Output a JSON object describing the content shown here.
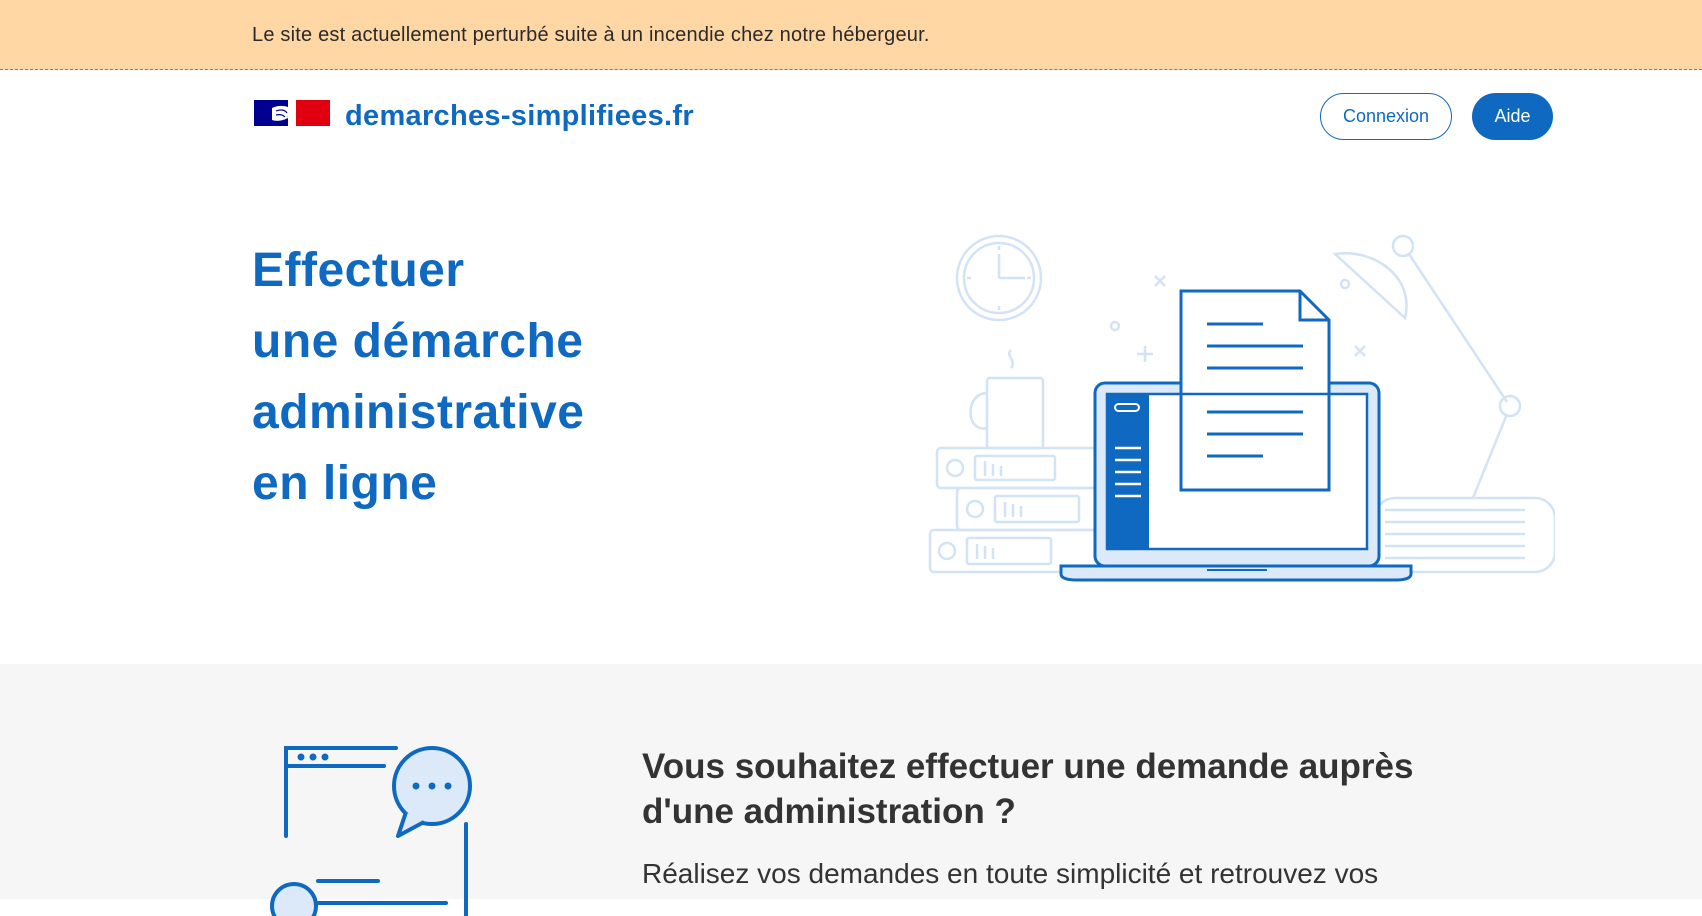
{
  "banner": {
    "text": "Le site est actuellement perturbé suite à un incendie chez notre hébergeur."
  },
  "header": {
    "logo_icon": "marianne-flag-logo",
    "site_name": "demarches-simplifiees.fr",
    "connexion_label": "Connexion",
    "aide_label": "Aide"
  },
  "hero": {
    "title_lines": [
      "Effectuer",
      "une démarche",
      "administrative",
      "en ligne"
    ],
    "illustration": "laptop-desk-illustration"
  },
  "section2": {
    "icon": "form-chat-icon",
    "title": "Vous souhaitez effectuer une demande auprès d'une administration ?",
    "text": "Réalisez vos demandes en toute simplicité et retrouvez vos"
  },
  "colors": {
    "brand_blue": "#0f69c0",
    "banner_bg": "#fed7a5",
    "section_bg": "#f6f6f6",
    "flag_red": "#e1000f",
    "flag_blue": "#000091"
  }
}
